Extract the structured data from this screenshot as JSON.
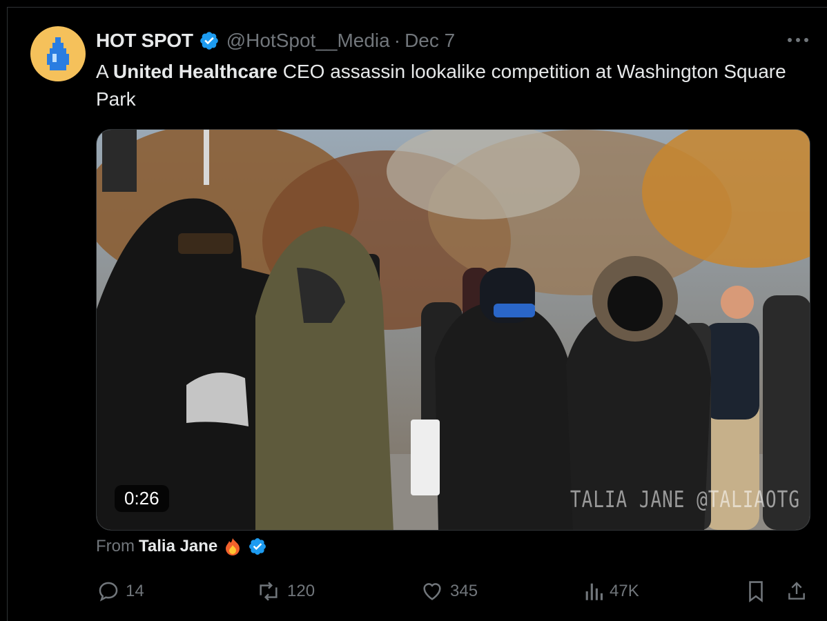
{
  "post": {
    "display_name": "HOT SPOT",
    "handle": "@HotSpot__Media",
    "separator": "·",
    "date": "Dec 7",
    "text_prefix": "A ",
    "text_bold": "United Healthcare",
    "text_suffix": " CEO assassin lookalike competition at Washington Square Park"
  },
  "media": {
    "duration": "0:26",
    "watermark": "TALIA JANE @TALIAOTG"
  },
  "attribution": {
    "from_label": "From",
    "author": "Talia Jane"
  },
  "actions": {
    "replies": "14",
    "reposts": "120",
    "likes": "345",
    "views": "47K"
  },
  "colors": {
    "background": "#000000",
    "text_primary": "#e7e9ea",
    "text_secondary": "#71767b",
    "verified": "#1d9bf0",
    "avatar_bg": "#f5c15b",
    "avatar_icon": "#2a7de1"
  },
  "icons": [
    "water-drop-icon",
    "verified-icon",
    "more-icon",
    "fire-emoji-icon",
    "reply-icon",
    "repost-icon",
    "like-icon",
    "views-icon",
    "bookmark-icon",
    "share-icon"
  ]
}
